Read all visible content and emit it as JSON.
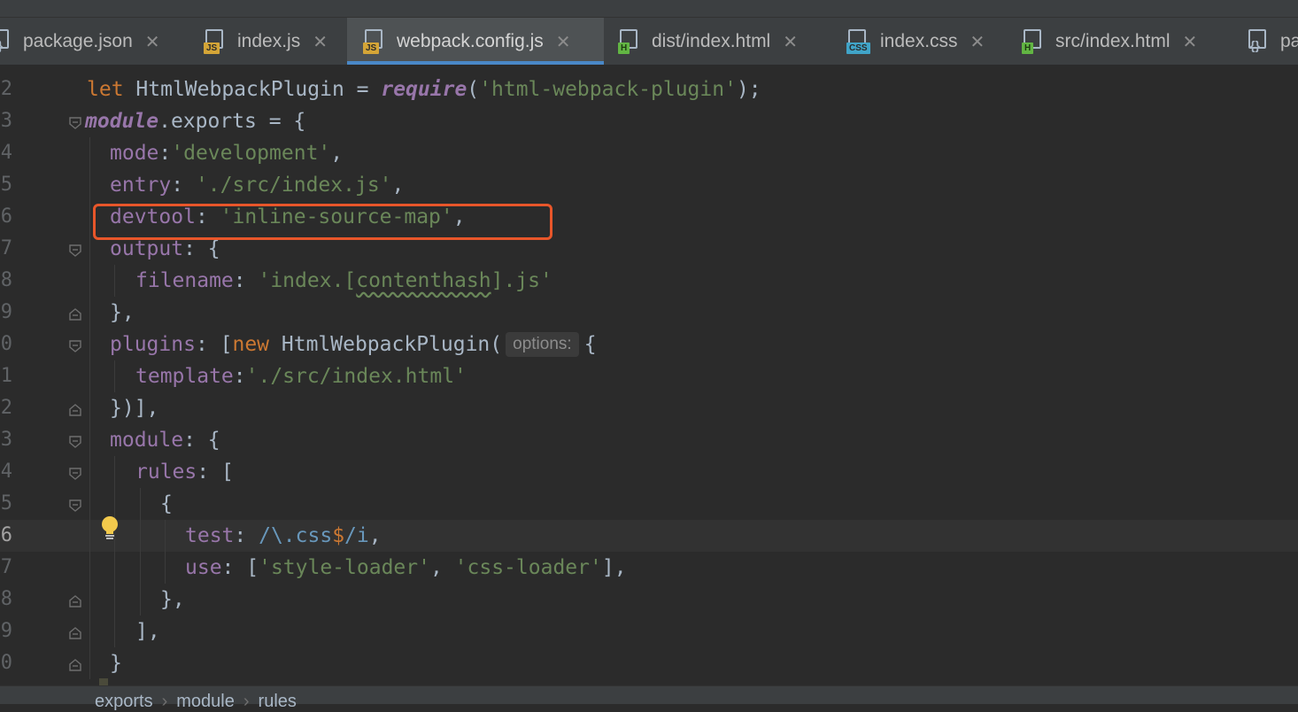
{
  "tabs": [
    {
      "label": "package.json",
      "icon": "json-file-icon",
      "badge": "{}"
    },
    {
      "label": "index.js",
      "icon": "js-file-icon",
      "badge": "JS"
    },
    {
      "label": "webpack.config.js",
      "icon": "js-file-icon",
      "badge": "JS",
      "active": true
    },
    {
      "label": "dist/index.html",
      "icon": "html-file-icon",
      "badge": "H"
    },
    {
      "label": "index.css",
      "icon": "css-file-icon",
      "badge": "CSS"
    },
    {
      "label": "src/index.html",
      "icon": "html-file-icon",
      "badge": "H"
    },
    {
      "label": "pa",
      "icon": "json-file-icon",
      "badge": "{}"
    }
  ],
  "tab_close_glyph": "✕",
  "gutter": {
    "line_numbers": [
      "2",
      "3",
      "4",
      "5",
      "6",
      "7",
      "8",
      "9",
      "0",
      "1",
      "2",
      "3",
      "4",
      "5",
      "6",
      "7",
      "8",
      "9",
      "0"
    ],
    "current_line": "6"
  },
  "code": {
    "line_2": {
      "kw": "let",
      "name": "HtmlWebpackPlugin",
      "eq": " = ",
      "fn": "require",
      "open": "(",
      "str": "'html-webpack-plugin'",
      "close": ");"
    },
    "line_3": {
      "mod": "module",
      "dot": ".exports = {"
    },
    "line_4": {
      "prop": "mode",
      "colon": ":",
      "str": "'development'",
      "end": ","
    },
    "line_5": {
      "prop": "entry",
      "colon": ": ",
      "str": "'./src/index.js'",
      "end": ","
    },
    "line_6": {
      "prop": "devtool",
      "colon": ": ",
      "str": "'inline-source-map'",
      "end": ","
    },
    "line_7": {
      "prop": "output",
      "rest": ": {"
    },
    "line_8": {
      "prop": "filename",
      "colon": ": ",
      "str_a": "'index.[",
      "str_b": "contenthash",
      "str_c": "].js'"
    },
    "line_9": {
      "text": "},"
    },
    "line_10": {
      "prop": "plugins",
      "colon": ": [",
      "kw": "new",
      "cls": " HtmlWebpackPlugin(",
      "hint": "options:",
      "brace": "{"
    },
    "line_11": {
      "prop": "template",
      "colon": ":",
      "str": "'./src/index.html'"
    },
    "line_12": {
      "text": "})],"
    },
    "line_13": {
      "prop": "module",
      "rest": ": {"
    },
    "line_14": {
      "prop": "rules",
      "rest": ": ["
    },
    "line_15": {
      "text": "{"
    },
    "line_16": {
      "prop": "test",
      "colon": ": ",
      "rx1": "/\\.css",
      "rx2": "$",
      "rx3": "/i",
      "end": ","
    },
    "line_17": {
      "prop": "use",
      "colon": ": [",
      "str1": "'style-loader'",
      "comma": ", ",
      "str2": "'css-loader'",
      "end": "],"
    },
    "line_18": {
      "text": "},"
    },
    "line_19": {
      "text": "],"
    },
    "line_20": {
      "text": "}"
    }
  },
  "breadcrumbs": [
    "exports",
    "module",
    "rules"
  ],
  "breadcrumb_separator": "›",
  "colors": {
    "highlight": "#e8562a",
    "active_tab_underline": "#4a88c7",
    "string": "#6a8759",
    "keyword": "#cc7832",
    "property": "#9876aa"
  }
}
